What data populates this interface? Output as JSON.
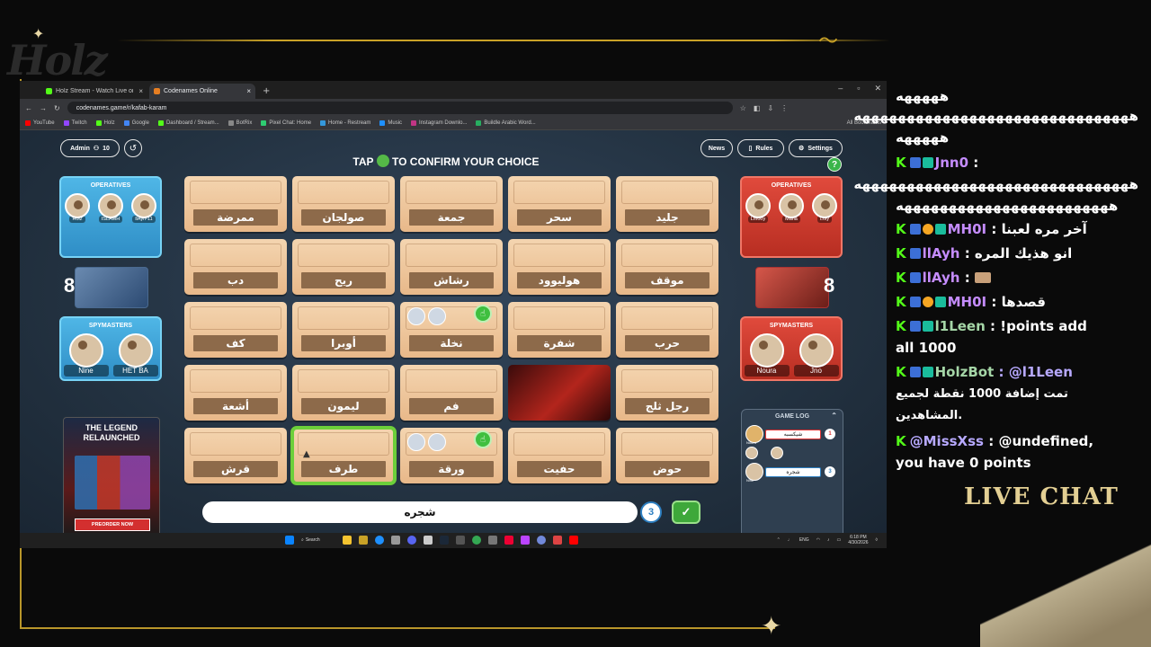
{
  "browser": {
    "tabs": [
      {
        "title": "Holz Stream - Watch Live on Ki",
        "active": false
      },
      {
        "title": "Codenames Online",
        "active": true
      }
    ],
    "new_tab": "+",
    "url": "codenames.game/r/kafab-karam",
    "bookmarks": [
      "YouTube",
      "Twitch",
      "Holz",
      "Google",
      "Dashboard / Stream...",
      "BotRix",
      "Pixel Chat: Home",
      "Home - Restream",
      "Music",
      "Instagram Downlo...",
      "Buildle Arabic Word..."
    ],
    "all_bookmarks": "All Bookmarks"
  },
  "game": {
    "admin_label": "Admin",
    "players_count": "10",
    "news": "News",
    "rules": "Rules",
    "settings": "Settings",
    "instruction_pre": "TAP",
    "instruction_post": "TO CONFIRM YOUR CHOICE",
    "blue_team": {
      "operatives_title": "OPERATIVES",
      "operatives": [
        "Holz",
        "ISLAMH",
        "llAyh-11"
      ],
      "count": "8",
      "spymasters_title": "SPYMASTERS",
      "spymasters": [
        "Nine",
        "HET BA"
      ]
    },
    "red_team": {
      "operatives_title": "OPERATIVES",
      "operatives": [
        "Lmooy",
        "Maha",
        "Loly"
      ],
      "count": "8",
      "spymasters_title": "SPYMASTERS",
      "spymasters": [
        "Noura",
        "Jno"
      ]
    },
    "promo": {
      "title": "THE LEGEND RELAUNCHED",
      "button": "PREORDER NOW"
    },
    "cards": [
      "ممرضة",
      "صولجان",
      "جمعة",
      "سحر",
      "جليد",
      "دب",
      "ريح",
      "رشاش",
      "هوليوود",
      "موقف",
      "كف",
      "أوبرا",
      "نخلة",
      "شفرة",
      "حرب",
      "أشعة",
      "ليمون",
      "فم",
      "",
      "رجل ثلج",
      "قرش",
      "طرف",
      "ورقة",
      "حفيت",
      "حوض"
    ],
    "clue_word": "شجره",
    "clue_number": "3",
    "game_log": {
      "title": "GAME LOG",
      "entries": [
        {
          "player": "Noura",
          "text": "شيكسبه",
          "number": "1"
        },
        {
          "player": "Nine",
          "text": "شجره",
          "number": "3"
        }
      ]
    }
  },
  "taskbar": {
    "search": "Search",
    "lang": "ENG",
    "time": "6:18 PM",
    "date": "4/30/2026"
  },
  "chat": {
    "lines": [
      {
        "user": "",
        "text": "هههههه"
      },
      {
        "user": "",
        "text": "هههههههههههههههههههههههههههههههه"
      },
      {
        "user": "",
        "text": "هههههه"
      },
      {
        "user": "Jnn0",
        "text": ":"
      },
      {
        "user": "",
        "text": "هههههههههههههههههههههههههههههههه"
      },
      {
        "user": "",
        "text": "ههههههههههههههههههههههههه"
      },
      {
        "user": "MH0I",
        "text": ": آخر مره لعبنا"
      },
      {
        "user": "llAyh",
        "text": ": انو هذيك المره"
      },
      {
        "user": "llAyh",
        "text": ":"
      },
      {
        "user": "MH0I",
        "text": ": قصدها"
      },
      {
        "user": "l1Leen",
        "text": ": !points add"
      },
      {
        "user": "",
        "text": "all 1000"
      },
      {
        "user": "HolzBot",
        "text": ": @l1Leen"
      },
      {
        "user": "",
        "text": "تمت إضافة 1000 نقطة لجميع"
      },
      {
        "user": "",
        "text": "المشاهدين."
      },
      {
        "user": "@MissXss",
        "text": ": @undefined,"
      },
      {
        "user": "",
        "text": "you have 0 points"
      }
    ],
    "footer": "LIVE CHAT"
  }
}
